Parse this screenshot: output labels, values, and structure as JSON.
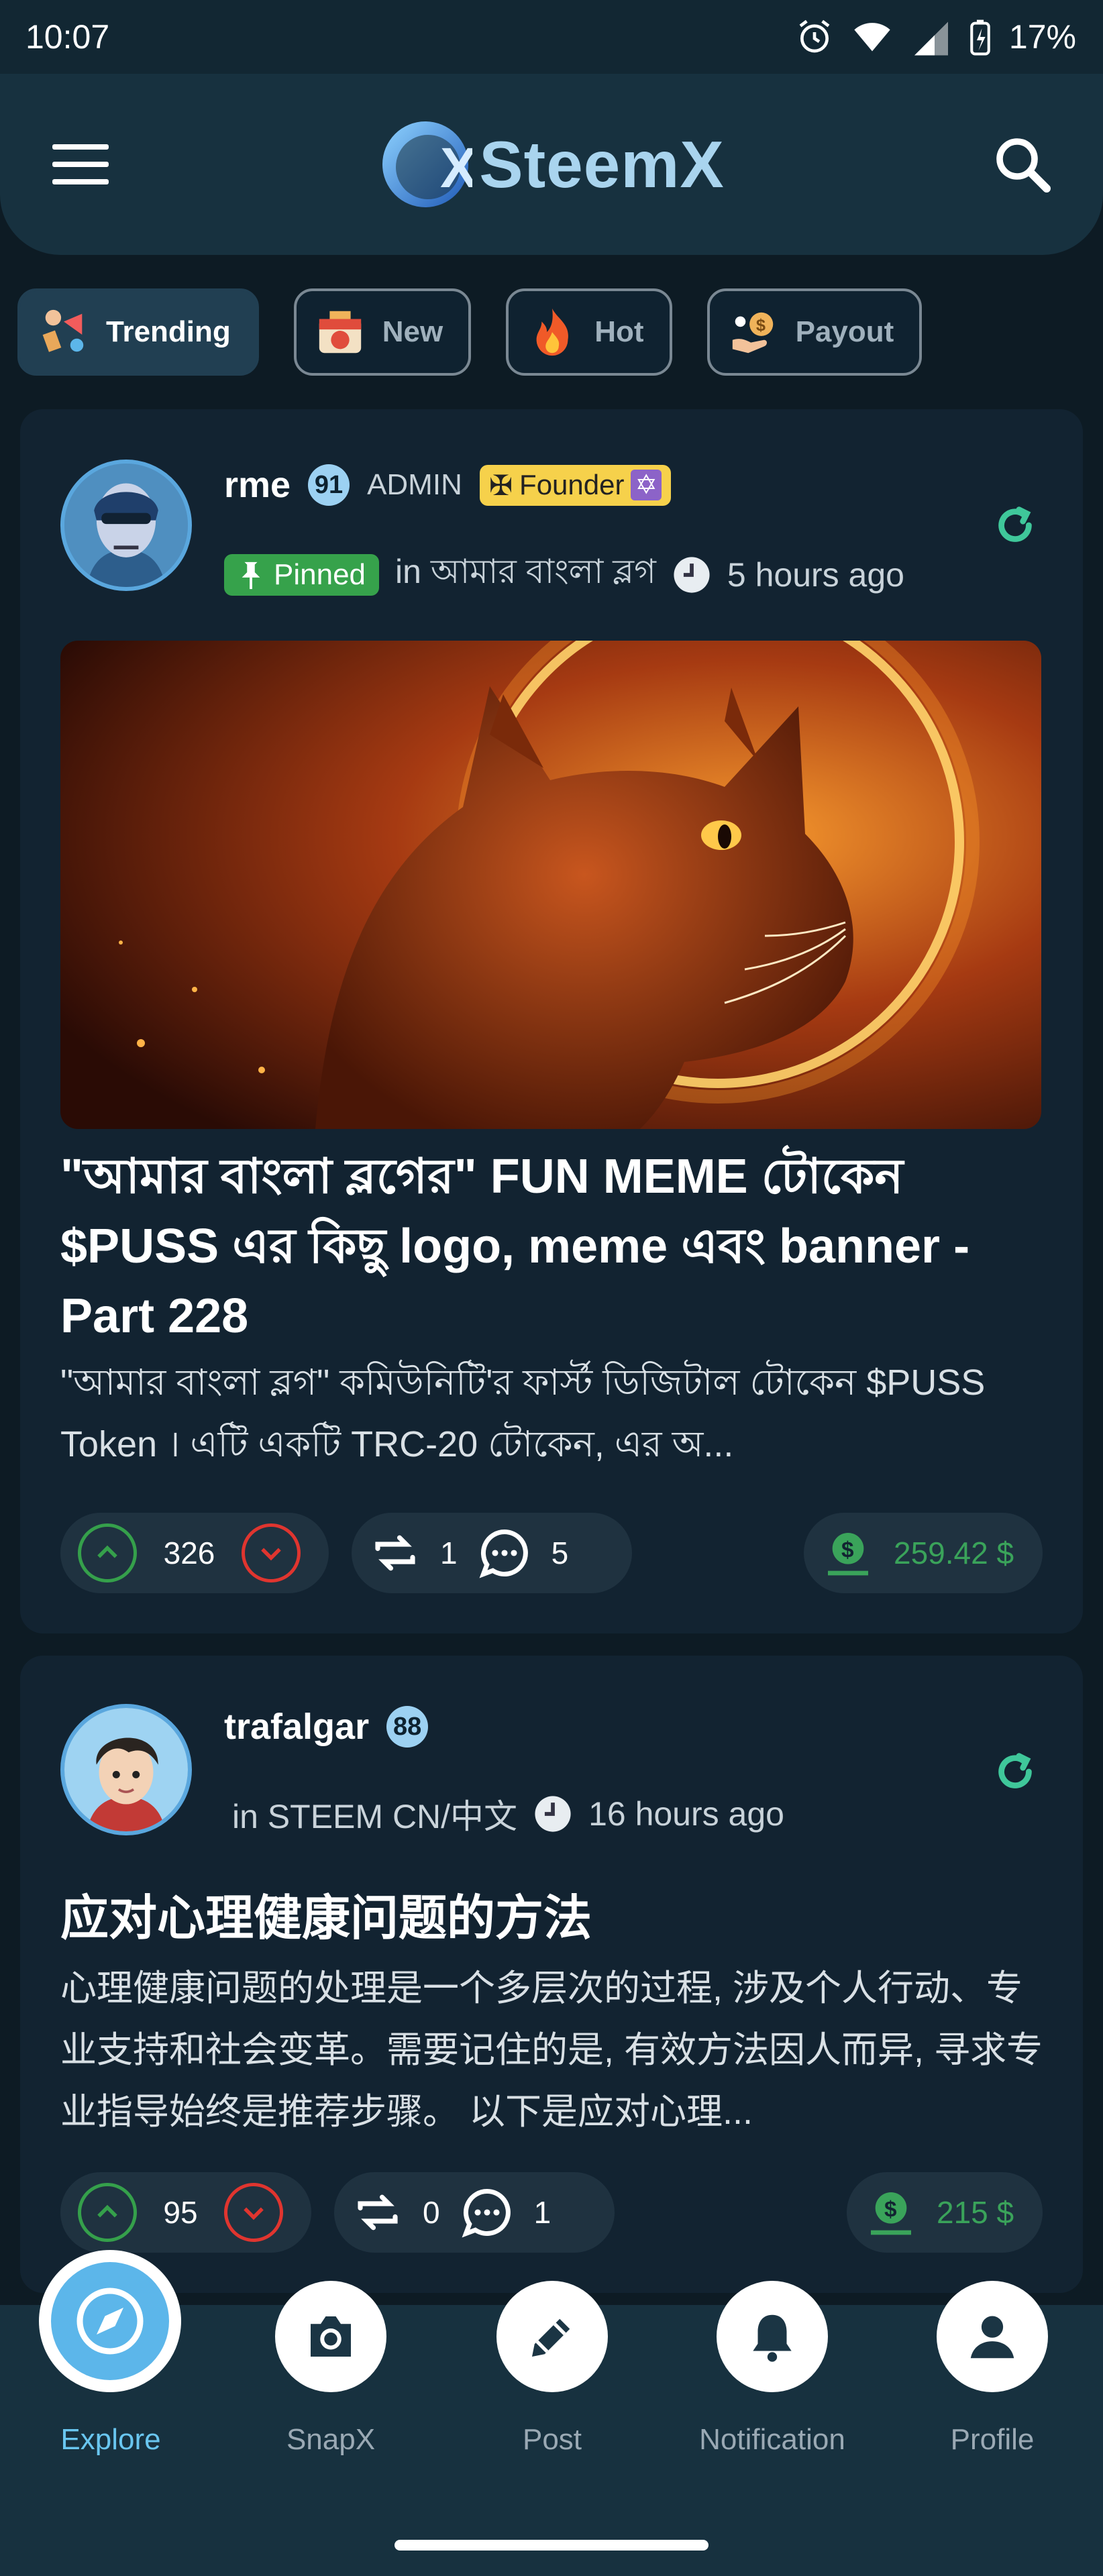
{
  "status_bar": {
    "time": "10:07",
    "battery": "17%"
  },
  "header": {
    "app_name": "SteemX",
    "logo_letter": "X",
    "menu_icon": "hamburger-icon",
    "search_icon": "search-icon"
  },
  "tabs": [
    {
      "label": "Trending",
      "active": true,
      "icon": "trending-icon"
    },
    {
      "label": "New",
      "active": false,
      "icon": "new-icon"
    },
    {
      "label": "Hot",
      "active": false,
      "icon": "flame-icon"
    },
    {
      "label": "Payout",
      "active": false,
      "icon": "payout-icon"
    }
  ],
  "posts": [
    {
      "author": "rme",
      "reputation": "91",
      "role": "ADMIN",
      "badge": "Founder",
      "pinned_label": "Pinned",
      "community": "in আমার বাংলা ব্লগ",
      "time_ago": "5 hours ago",
      "title": "\"আমার বাংলা ব্লগের\" FUN MEME টোকেন $PUSS এর কিছু logo, meme  এবং banner - Part 228",
      "excerpt": "\"আমার বাংলা ব্লগ\" কমিউনিটি'র ফার্স্ট ডিজিটাল টোকেন $PUSS Token । এটি একটি TRC-20 টোকেন, এর অ...",
      "votes": "326",
      "resteems": "1",
      "comments": "5",
      "payout": "259.42 $"
    },
    {
      "author": "trafalgar",
      "reputation": "88",
      "community": "in STEEM CN/中文",
      "time_ago": "16 hours ago",
      "title": "应对心理健康问题的方法",
      "excerpt": "心理健康问题的处理是一个多层次的过程, 涉及个人行动、专业支持和社会变革。需要记住的是, 有效方法因人而异, 寻求专业指导始终是推荐步骤。 以下是应对心理...",
      "votes": "95",
      "resteems": "0",
      "comments": "1",
      "payout": "215 $"
    }
  ],
  "bottom_nav": [
    {
      "label": "Explore",
      "active": true,
      "icon": "compass-icon"
    },
    {
      "label": "SnapX",
      "active": false,
      "icon": "camera-icon"
    },
    {
      "label": "Post",
      "active": false,
      "icon": "edit-icon"
    },
    {
      "label": "Notification",
      "active": false,
      "icon": "bell-icon"
    },
    {
      "label": "Profile",
      "active": false,
      "icon": "person-icon"
    }
  ],
  "colors": {
    "upvote": "#35a04b",
    "downvote": "#e0352f",
    "payout": "#3aa35a",
    "accent": "#69c6f0",
    "background": "#0d1b24"
  }
}
